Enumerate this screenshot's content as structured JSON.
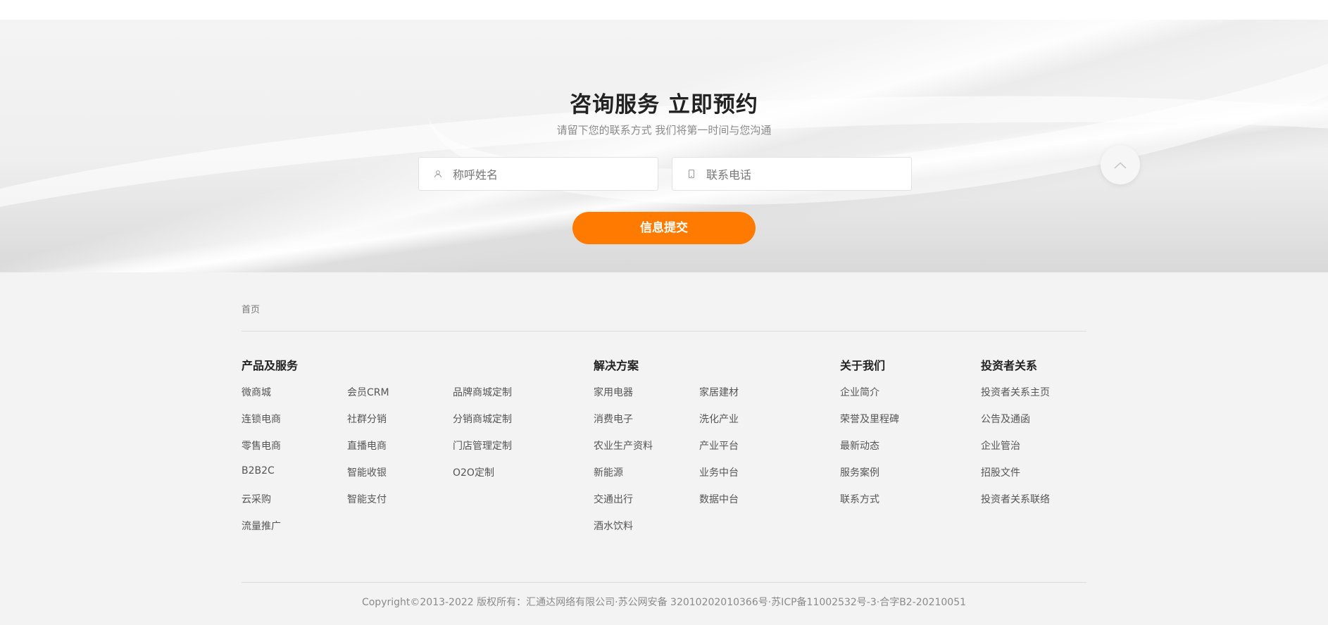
{
  "consult": {
    "title": "咨询服务 立即预约",
    "subtitle": "请留下您的联系方式 我们将第一时间与您沟通",
    "name_placeholder": "称呼姓名",
    "phone_placeholder": "联系电话",
    "submit_label": "信息提交"
  },
  "footer": {
    "breadcrumb": "首页",
    "columns": {
      "products": {
        "title": "产品及服务",
        "col1": [
          "微商城",
          "连锁电商",
          "零售电商",
          "B2B2C",
          "云采购",
          "流量推广"
        ],
        "col2": [
          "会员CRM",
          "社群分销",
          "直播电商",
          "智能收银",
          "智能支付"
        ],
        "col3": [
          "品牌商城定制",
          "分销商城定制",
          "门店管理定制",
          "O2O定制"
        ]
      },
      "solutions": {
        "title": "解决方案",
        "col1": [
          "家用电器",
          "消费电子",
          "农业生产资料",
          "新能源",
          "交通出行",
          "酒水饮料"
        ],
        "col2": [
          "家居建材",
          "洗化产业",
          "产业平台",
          "业务中台",
          "数据中台"
        ]
      },
      "about": {
        "title": "关于我们",
        "items": [
          "企业简介",
          "荣誉及里程碑",
          "最新动态",
          "服务案例",
          "联系方式"
        ]
      },
      "investors": {
        "title": "投资者关系",
        "items": [
          "投资者关系主页",
          "公告及通函",
          "企业管治",
          "招股文件",
          "投资者关系联络"
        ]
      }
    },
    "copyright": "Copyright©2013-2022 版权所有：汇通达网络有限公司·苏公网安备 32010202010366号·苏ICP备11002532号-3·合字B2-20210051"
  },
  "colors": {
    "accent": "#ff7a00",
    "footer_bg": "#f3f3f4"
  },
  "icons": {
    "name_field": "user-icon",
    "phone_field": "phone-icon",
    "back_to_top": "chevron-up-icon"
  }
}
